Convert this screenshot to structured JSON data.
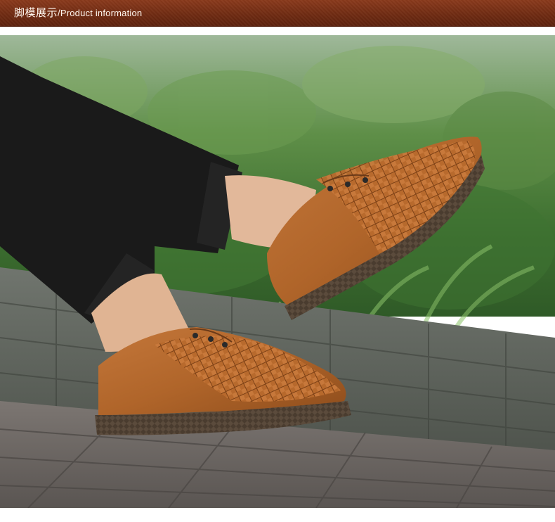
{
  "header": {
    "title_cn": "脚模展示",
    "separator": "/",
    "title_en": "Product information"
  },
  "photo": {
    "subject": "model-wearing-woven-leather-shoes",
    "colors": {
      "header_bg": "#6e2a12",
      "header_text": "#fff6ee",
      "shoe_leather": "#b5682b",
      "shoe_sole": "#5a4a3a",
      "trousers": "#1a1a1a",
      "foliage": "#4f8a3a",
      "deck": "#6f6a66"
    }
  }
}
